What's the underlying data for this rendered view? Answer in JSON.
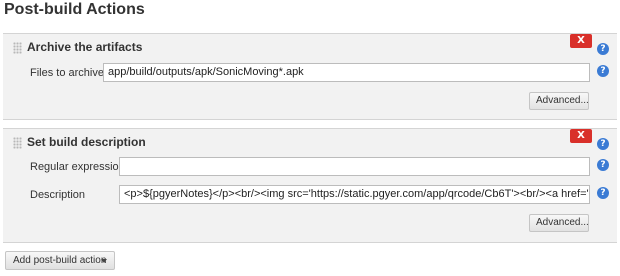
{
  "page": {
    "title": "Post-build Actions"
  },
  "archive": {
    "title": "Archive the artifacts",
    "delete_label": "X",
    "files_label": "Files to archive",
    "files_value": "app/build/outputs/apk/SonicMoving*.apk",
    "advanced_label": "Advanced..."
  },
  "description": {
    "title": "Set build description",
    "delete_label": "X",
    "regex_label": "Regular expression",
    "regex_value": "",
    "desc_label": "Description",
    "desc_value": "<p>${pgyerNotes}</p><br/><img src='https://static.pgyer.com/app/qrcode/Cb6T'><br/><a href='https://www.pg",
    "advanced_label": "Advanced..."
  },
  "help": {
    "glyph": "?"
  },
  "footer": {
    "add_label": "Add post-build action"
  }
}
